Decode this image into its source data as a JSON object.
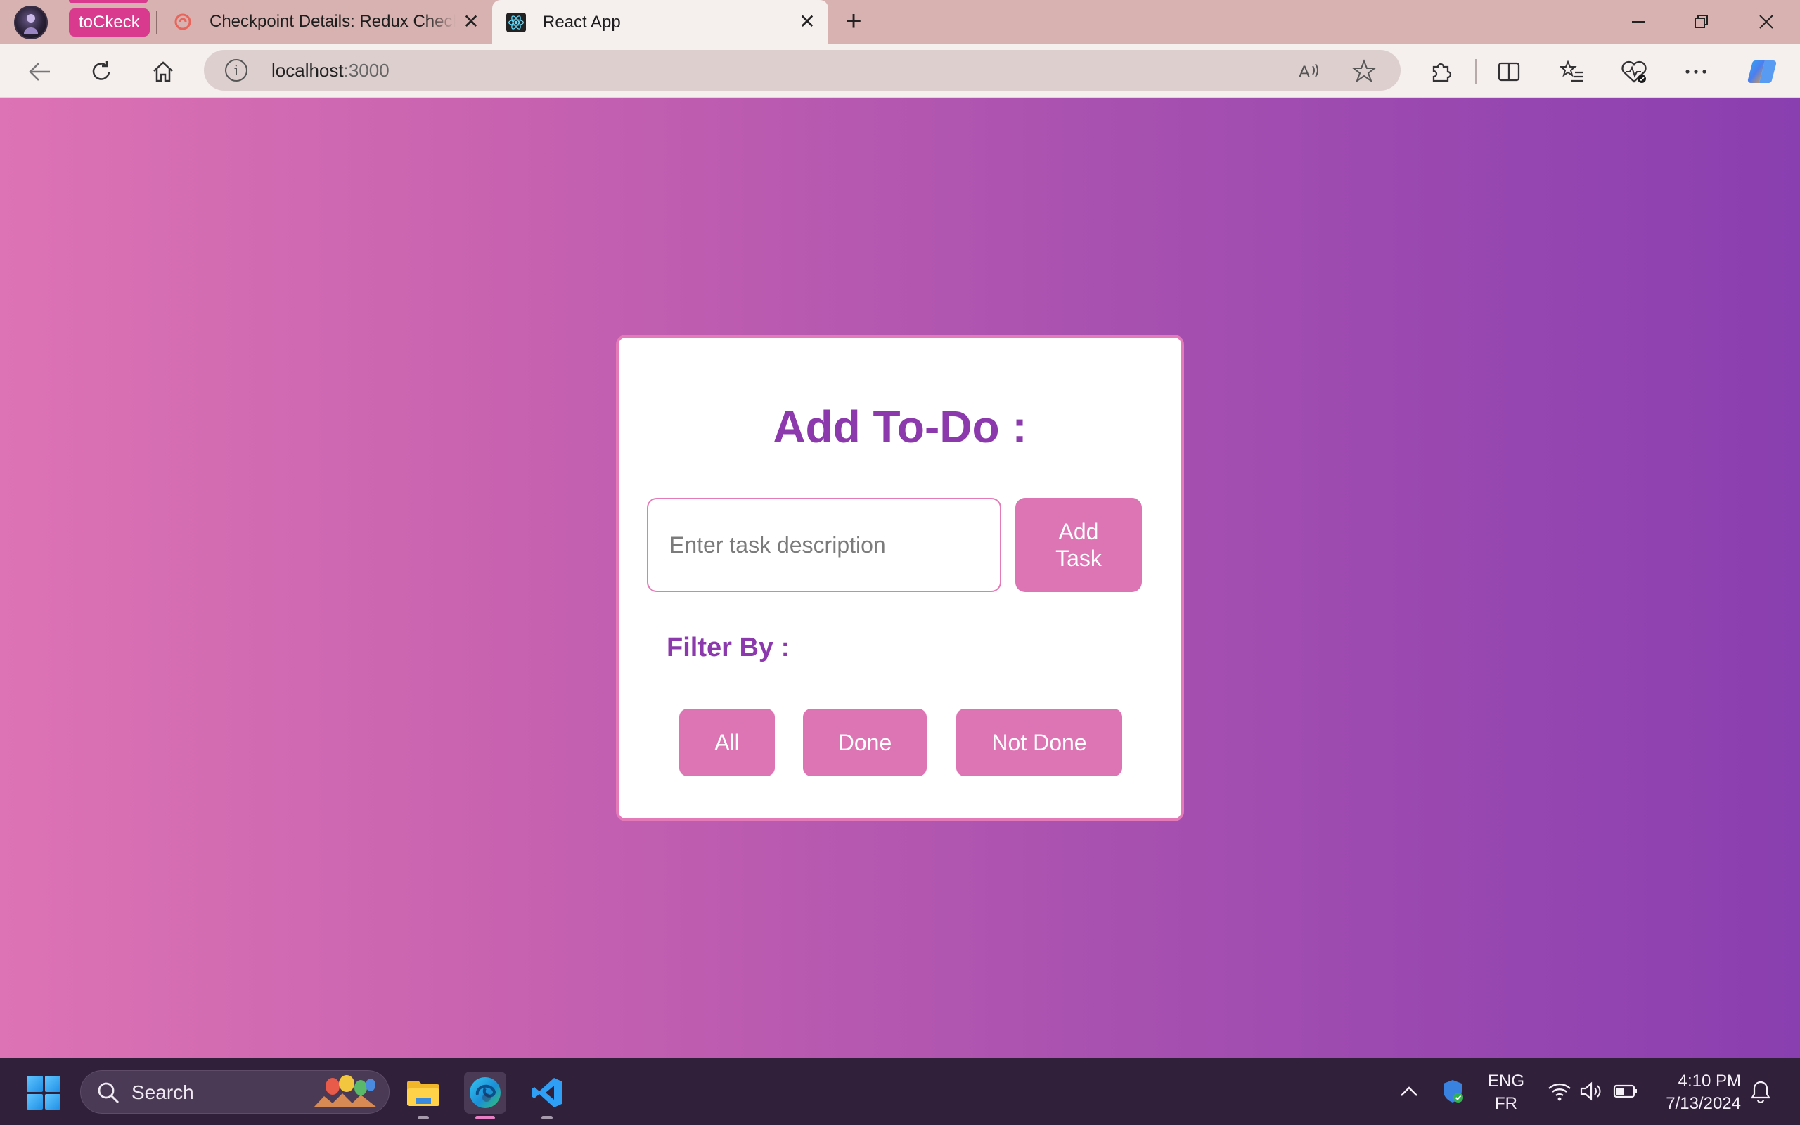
{
  "browser": {
    "tab_group_label": "toCkeck",
    "tabs": [
      {
        "title": "Checkpoint Details: Redux Checkpoint",
        "active": false
      },
      {
        "title": "React App",
        "active": true
      }
    ],
    "address": {
      "host": "localhost",
      "port": ":3000"
    },
    "toolbar_icons": [
      "back-icon",
      "refresh-icon",
      "home-icon",
      "read-aloud-icon",
      "favorite-star-icon",
      "extensions-icon",
      "split-screen-icon",
      "favorites-icon",
      "browser-essentials-icon",
      "more-icon",
      "copilot-icon"
    ]
  },
  "app": {
    "title": "Add To-Do :",
    "input": {
      "placeholder": "Enter task description",
      "value": ""
    },
    "add_button_label": "Add Task",
    "filter_label": "Filter By :",
    "filters": [
      "All",
      "Done",
      "Not Done"
    ],
    "colors": {
      "accent_purple": "#8c39ad",
      "button_pink": "#dd75b4",
      "border_pink": "#e47bb8"
    }
  },
  "taskbar": {
    "search_label": "Search",
    "apps": [
      "file-explorer-icon",
      "edge-icon",
      "vscode-icon"
    ],
    "language": {
      "line1": "ENG",
      "line2": "FR"
    },
    "time": "4:10 PM",
    "date": "7/13/2024"
  }
}
